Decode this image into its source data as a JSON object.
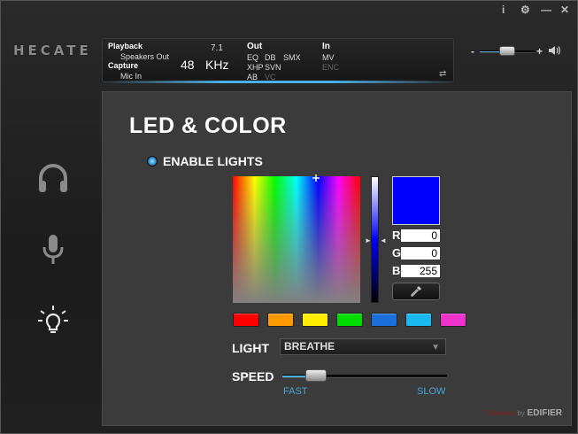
{
  "window": {
    "controls": {
      "info": "i",
      "settings": "⚙",
      "minimize": "—",
      "close": "✕"
    }
  },
  "logo": "HECATE",
  "status": {
    "playback_label": "Playback",
    "playback_device": "Speakers Out",
    "channels": "7.1",
    "capture_label": "Capture",
    "capture_device": "Mic In",
    "rate": "48",
    "rate_unit": "KHz",
    "out_label": "Out",
    "out_eq": "EQ",
    "out_db": "DB",
    "out_smx": "SMX",
    "out_xhp": "XHP",
    "out_svn": "SVN",
    "out_ab": "AB",
    "out_vc": "VC",
    "in_label": "In",
    "in_mv": "MV",
    "in_enc": "ENC",
    "swap_icon": "⇄"
  },
  "volume": {
    "minus": "-",
    "plus": "+",
    "level": 0.4
  },
  "nav": [
    {
      "name": "headphones",
      "icon": "headphones-icon"
    },
    {
      "name": "microphone",
      "icon": "microphone-icon"
    },
    {
      "name": "led",
      "icon": "bulb-icon"
    }
  ],
  "panel": {
    "title": "LED & COLOR",
    "enable_label": "ENABLE LIGHTS",
    "rgb": {
      "r_label": "R",
      "r": "0",
      "g_label": "G",
      "g": "0",
      "b_label": "B",
      "b": "255"
    },
    "selected_color": "#0000ff",
    "presets": [
      "#ff0000",
      "#ff9900",
      "#ffee00",
      "#00dd00",
      "#1a6fd8",
      "#1ab8f0",
      "#ee33cc"
    ],
    "light_label": "LIGHT",
    "light_mode": "BREATHE",
    "speed_label": "SPEED",
    "speed_fast": "FAST",
    "speed_slow": "SLOW",
    "speed_level": 0.22,
    "brand_powered": "Powered",
    "brand_by": "by",
    "brand_name": "EDIFIER"
  },
  "colors": {
    "accent": "#4ab0e0"
  }
}
